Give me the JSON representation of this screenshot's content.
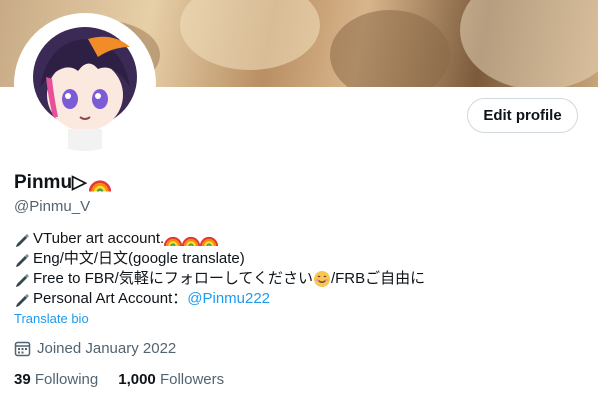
{
  "profile": {
    "display_name": "Pinmu▷",
    "handle": "@Pinmu_V",
    "edit_button": "Edit profile",
    "bio": {
      "line1": "VTuber art account.",
      "line2": "Eng/中文/日文(google translate)",
      "line3_a": "Free to FBR/気軽にフォローしてください",
      "line3_b": "/FRBご自由に",
      "line4_a": "Personal Art Account：",
      "line4_link": "@Pinmu222"
    },
    "translate_label": "Translate bio",
    "joined": "Joined January 2022",
    "following_count": "39",
    "following_label": "Following",
    "followers_count": "1,000",
    "followers_label": "Followers"
  },
  "icons": [
    "rainbow-icon",
    "pen-icon",
    "smile-emoji-icon",
    "calendar-icon"
  ],
  "colors": {
    "link": "#1d9bf0",
    "muted": "#536471",
    "text": "#0f1419",
    "border": "#cfd9de"
  }
}
